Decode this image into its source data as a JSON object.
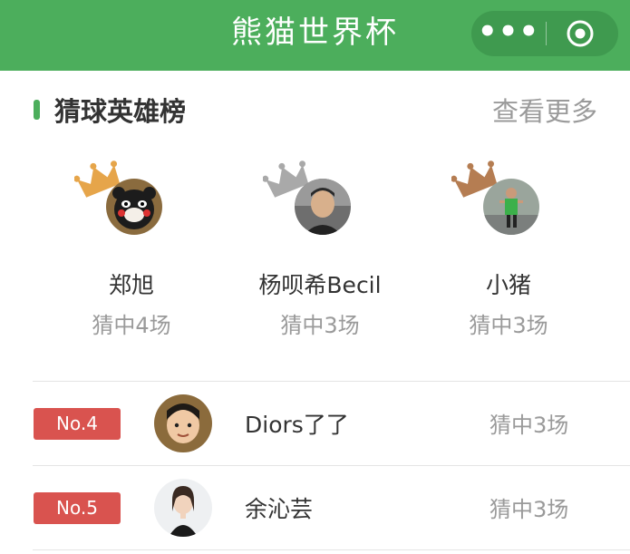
{
  "header": {
    "title": "熊猫世界杯",
    "more_icon": "more-dots-icon",
    "close_icon": "target-close-icon",
    "color": "#4cae5c"
  },
  "section": {
    "title": "猜球英雄榜",
    "more_label": "查看更多"
  },
  "podium": [
    {
      "name": "郑旭",
      "score": "猜中4场",
      "crown_color": "#e6a54a",
      "avatar": "bear-mascot"
    },
    {
      "name": "杨呗希Becil",
      "score": "猜中3场",
      "crown_color": "#a9a9a9",
      "avatar": "man-photo"
    },
    {
      "name": "小猪",
      "score": "猜中3场",
      "crown_color": "#b57d52",
      "avatar": "runner-photo"
    }
  ],
  "ranking": [
    {
      "rank": "No.4",
      "name": "Diors了了",
      "score": "猜中3场",
      "avatar": "child-photo"
    },
    {
      "rank": "No.5",
      "name": "余沁芸",
      "score": "猜中3场",
      "avatar": "woman-photo"
    }
  ],
  "colors": {
    "rank_badge": "#d9534f",
    "muted_text": "#9a9a9a"
  }
}
